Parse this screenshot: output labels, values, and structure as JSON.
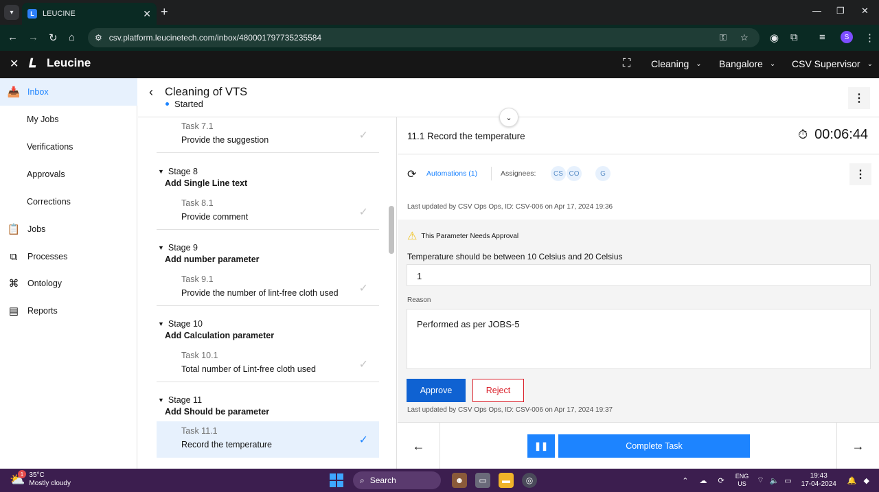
{
  "browser": {
    "tab_title": "LEUCINE",
    "url": "csv.platform.leucinetech.com/inbox/480001797735235584",
    "profile_initial": "S"
  },
  "app": {
    "brand": "Leucine",
    "header_items": [
      {
        "label": "Cleaning"
      },
      {
        "label": "Bangalore"
      },
      {
        "label": "CSV Supervisor"
      }
    ]
  },
  "sidebar": {
    "items": [
      {
        "label": "Inbox",
        "icon": "inbox-icon",
        "active": true
      },
      {
        "label": "My Jobs"
      },
      {
        "label": "Verifications"
      },
      {
        "label": "Approvals"
      },
      {
        "label": "Corrections"
      },
      {
        "label": "Jobs",
        "icon": "clipboard-icon"
      },
      {
        "label": "Processes",
        "icon": "flow-icon"
      },
      {
        "label": "Ontology",
        "icon": "hierarchy-icon"
      },
      {
        "label": "Reports",
        "icon": "report-icon"
      }
    ]
  },
  "page": {
    "title": "Cleaning of VTS",
    "status": "Started"
  },
  "stages": [
    {
      "stage": "",
      "name": "",
      "task_num": "Task 7.1",
      "task_name": "Provide the suggestion"
    },
    {
      "stage": "Stage 8",
      "name": "Add Single Line text",
      "task_num": "Task 8.1",
      "task_name": "Provide comment"
    },
    {
      "stage": "Stage 9",
      "name": "Add number parameter",
      "task_num": "Task 9.1",
      "task_name": "Provide the number of lint-free cloth used"
    },
    {
      "stage": "Stage 10",
      "name": "Add Calculation parameter",
      "task_num": "Task 10.1",
      "task_name": "Total number of Lint-free cloth used"
    },
    {
      "stage": "Stage 11",
      "name": "Add Should be parameter",
      "task_num": "Task 11.1",
      "task_name": "Record the temperature"
    }
  ],
  "task": {
    "title": "11.1 Record the temperature",
    "timer": "00:06:44",
    "automations": "Automations (1)",
    "assignees_label": "Assignees:",
    "assignees": [
      "CS",
      "CO",
      "G"
    ],
    "last_updated_top": "Last updated by CSV Ops Ops, ID: CSV-006 on Apr 17, 2024 19:36",
    "approval_warning": "This Parameter Needs Approval",
    "param_label": "Temperature should be between 10 Celsius and 20 Celsius",
    "param_value": "1",
    "reason_label": "Reason",
    "reason_value": "Performed as per JOBS-5",
    "approve_label": "Approve",
    "reject_label": "Reject",
    "last_updated_bottom": "Last updated by CSV Ops Ops, ID: CSV-006 on Apr 17, 2024 19:37",
    "complete_label": "Complete Task"
  },
  "taskbar": {
    "temp": "35°C",
    "weather": "Mostly cloudy",
    "search": "Search",
    "lang1": "ENG",
    "lang2": "US",
    "time": "19:43",
    "date": "17-04-2024",
    "badge": "1"
  }
}
